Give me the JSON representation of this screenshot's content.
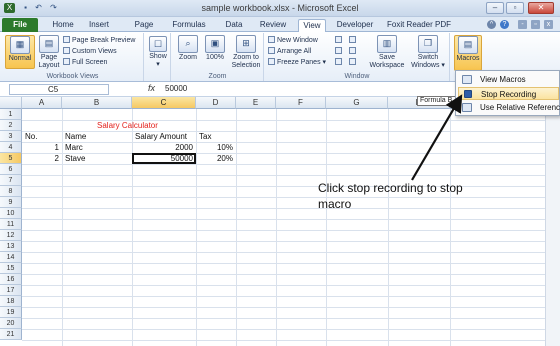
{
  "window": {
    "title": "sample workbook.xlsx - Microsoft Excel"
  },
  "qat": {
    "save_icon": "save-icon",
    "undo_glyph": "↶",
    "redo_glyph": "↷"
  },
  "tabs": [
    {
      "label": "File"
    },
    {
      "label": "Home"
    },
    {
      "label": "Insert"
    },
    {
      "label": "Page Layout"
    },
    {
      "label": "Formulas"
    },
    {
      "label": "Data"
    },
    {
      "label": "Review"
    },
    {
      "label": "View"
    },
    {
      "label": "Developer"
    },
    {
      "label": "Foxit Reader PDF"
    }
  ],
  "ribbon": {
    "workbook_views": {
      "label": "Workbook Views",
      "normal": "Normal",
      "page_layout": "Page Layout",
      "page_break_preview": "Page Break Preview",
      "custom_views": "Custom Views",
      "full_screen": "Full Screen"
    },
    "show": {
      "label": "Show"
    },
    "zoom": {
      "label": "Zoom",
      "zoom": "Zoom",
      "hundred": "100%",
      "zoom_to_selection": "Zoom to Selection"
    },
    "window": {
      "label": "Window",
      "new_window": "New Window",
      "arrange_all": "Arrange All",
      "freeze_panes": "Freeze Panes",
      "save_workspace": "Save Workspace",
      "switch_windows": "Switch Windows"
    },
    "macros": {
      "label": "Macros"
    }
  },
  "formula_bar": {
    "name_box": "C5",
    "fx": "fx",
    "value": "50000"
  },
  "columns": [
    "A",
    "B",
    "C",
    "D",
    "E",
    "F",
    "G",
    "H"
  ],
  "rows": [
    "1",
    "2",
    "3",
    "4",
    "5",
    "6",
    "7",
    "8",
    "9",
    "10",
    "11",
    "12",
    "13",
    "14",
    "15",
    "16",
    "17",
    "18",
    "19",
    "20",
    "21"
  ],
  "cells": {
    "title": "Salary Calculator",
    "a3": "No.",
    "b3": "Name",
    "c3": "Salary Amount",
    "d3": "Tax",
    "a4": "1",
    "b4": "Marc",
    "c4": "2000",
    "d4": "10%",
    "a5": "2",
    "b5": "Stave",
    "c5": "50000",
    "d5": "20%"
  },
  "macros_menu": {
    "view_macros": "View Macros",
    "stop_recording": "Stop Recording",
    "use_relative": "Use Relative References"
  },
  "tooltip": "Formula B",
  "annotation": "Click stop recording to stop macro",
  "colors": {
    "title_red": "#e3211c",
    "file_green": "#2c7a2c",
    "selection_gold": "#f7c44f"
  }
}
